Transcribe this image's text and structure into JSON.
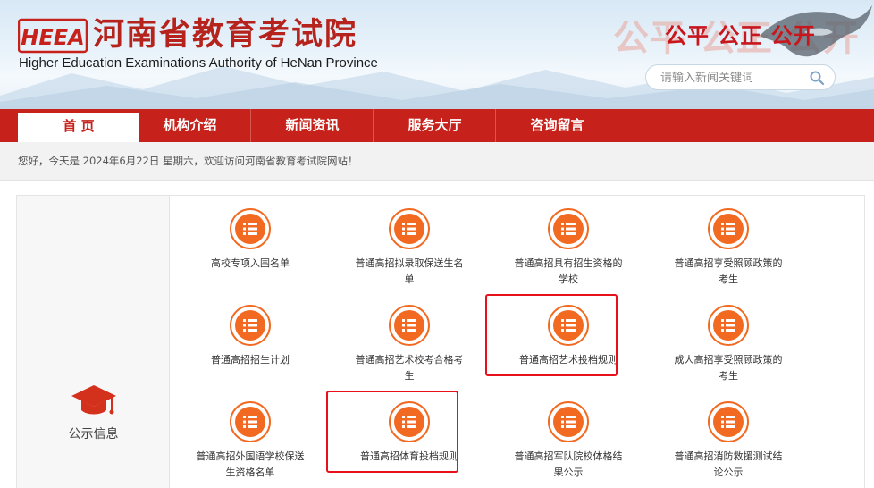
{
  "header": {
    "logo_text": "HEEA",
    "title": "河南省教育考试院",
    "subtitle": "Higher Education Examinations Authority of HeNan Province",
    "slogan_ghost": "公平 公正 公开",
    "slogan": "公平 公正 公开",
    "accent_color": "#c6221b"
  },
  "search": {
    "placeholder": "请输入新闻关键词",
    "icon": "search-icon"
  },
  "nav": {
    "items": [
      {
        "label": "首 页",
        "active": true
      },
      {
        "label": "机构介绍",
        "active": false
      },
      {
        "label": "新闻资讯",
        "active": false
      },
      {
        "label": "服务大厅",
        "active": false
      },
      {
        "label": "咨询留言",
        "active": false
      }
    ]
  },
  "greeting": "您好，今天是 2024年6月22日 星期六，欢迎访问河南省教育考试院网站！",
  "sidebar": {
    "label": "公示信息",
    "icon": "graduation-cap-icon"
  },
  "items": [
    {
      "label": "高校专项入围名单",
      "highlighted": false
    },
    {
      "label": "普通高招拟录取保送生名单",
      "highlighted": false
    },
    {
      "label": "普通高招具有招生资格的学校",
      "highlighted": false
    },
    {
      "label": "普通高招享受照顾政策的考生",
      "highlighted": false
    },
    {
      "label": "普通高招招生计划",
      "highlighted": false
    },
    {
      "label": "普通高招艺术校考合格考生",
      "highlighted": false
    },
    {
      "label": "普通高招艺术投档规则",
      "highlighted": true
    },
    {
      "label": "成人高招享受照顾政策的考生",
      "highlighted": false
    },
    {
      "label": "普通高招外国语学校保送生资格名单",
      "highlighted": false
    },
    {
      "label": "普通高招体育投档规则",
      "highlighted": true
    },
    {
      "label": "普通高招军队院校体格结果公示",
      "highlighted": false
    },
    {
      "label": "普通高招消防救援测试结论公示",
      "highlighted": false
    }
  ],
  "colors": {
    "icon_orange": "#f26a21",
    "highlight_red": "#e8101a"
  }
}
